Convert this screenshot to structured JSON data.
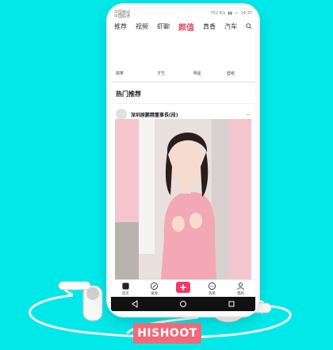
{
  "status_bar": {
    "carrier_top": "中国移动",
    "carrier_bottom": "中国联通",
    "speed": "752 K/s",
    "time": "14:37"
  },
  "tabs": [
    {
      "label": "推荐",
      "active": false
    },
    {
      "label": "视频",
      "active": false
    },
    {
      "label": "虾聊",
      "active": false
    },
    {
      "label": "颜值",
      "active": true
    },
    {
      "label": "真香",
      "active": false
    },
    {
      "label": "汽车",
      "active": false
    }
  ],
  "categories": [
    "搞笑",
    "才艺",
    "明星",
    "壁纸"
  ],
  "section_title": "热门推荐",
  "post": {
    "user_name": "深圳原鹏精董事長(段)"
  },
  "bottom_nav": [
    {
      "label": "首页",
      "icon": "home-icon"
    },
    {
      "label": "发现",
      "icon": "compass-icon"
    },
    {
      "label": "",
      "icon": "plus-icon"
    },
    {
      "label": "消息",
      "icon": "message-icon"
    },
    {
      "label": "我的",
      "icon": "profile-icon"
    }
  ],
  "brand_label": "HISHOOT",
  "colors": {
    "background": "#00e8e8",
    "accent": "#e84e6a",
    "plus_button": "#f0386a",
    "brand": "#f26a7a"
  }
}
